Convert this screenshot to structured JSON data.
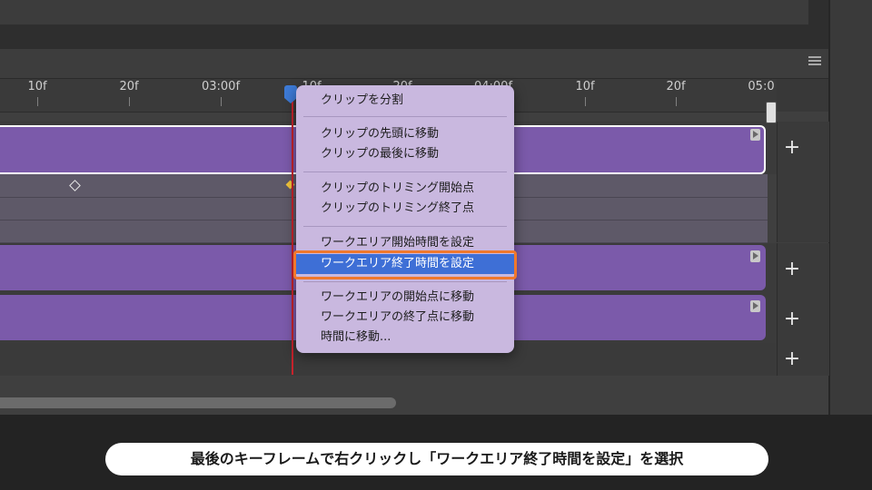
{
  "ruler": {
    "labels": [
      "10f",
      "20f",
      "03:00f",
      "10f",
      "20f",
      "04:00f",
      "10f",
      "20f",
      "05:0"
    ]
  },
  "tracks": {
    "add_label": "+"
  },
  "context_menu": {
    "items": [
      "クリップを分割",
      "クリップの先頭に移動",
      "クリップの最後に移動",
      "クリップのトリミング開始点",
      "クリップのトリミング終了点",
      "ワークエリア開始時間を設定",
      "ワークエリア終了時間を設定",
      "ワークエリアの開始点に移動",
      "ワークエリアの終了点に移動",
      "時間に移動..."
    ],
    "highlighted_index": 6
  },
  "caption": {
    "text": "最後のキーフレームで右クリックし「ワークエリア終了時間を設定」を選択"
  },
  "colors": {
    "clip": "#7b5aaa",
    "menu_bg": "#c9b8df",
    "highlight": "#3e6fd6",
    "callout": "#f0782c",
    "playhead": "#c8232c"
  }
}
